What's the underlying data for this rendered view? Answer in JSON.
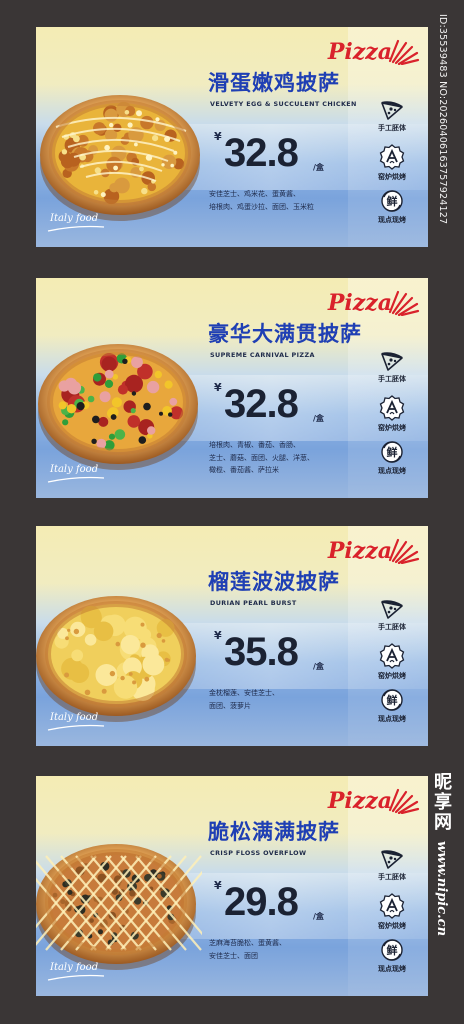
{
  "watermark_id": "ID:35539483 NO:20260406163757924127",
  "site": {
    "brand": "昵享网",
    "url": "www.nipic.cn"
  },
  "colors": {
    "title_blue": "#1f3fb4",
    "logo_red": "#d9222b",
    "background": "#3a3636"
  },
  "cards": [
    {
      "logo": "Pizza",
      "title": "滑蛋嫩鸡披萨",
      "subtitle": "VELVETY EGG & SUCCULENT CHICKEN",
      "currency": "¥",
      "price": "32.8",
      "unit": "/盒",
      "ingredients": [
        "安佳芝士、鸡米花、蛋黄酱、",
        "培根肉、鸡蛋沙拉、面团、玉米粒"
      ],
      "features": [
        {
          "icon": "pizza-slice-icon",
          "label": "手工胚体"
        },
        {
          "icon": "oven-badge-icon",
          "label": "窑炉烘烤"
        },
        {
          "icon": "fresh-badge-icon",
          "label": "现点现烤",
          "badge": "鲜"
        }
      ],
      "tagline": "Italy food"
    },
    {
      "logo": "Pizza",
      "title": "豪华大满贯披萨",
      "subtitle": "SUPREME CARNIVAL PIZZA",
      "currency": "¥",
      "price": "32.8",
      "unit": "/盒",
      "ingredients": [
        "培根肉、青椒、番茄、香肠、",
        "芝士、蘑菇、面团、火腿、洋葱、",
        "橄榄、番茄酱、萨拉米"
      ],
      "features": [
        {
          "icon": "pizza-slice-icon",
          "label": "手工胚体"
        },
        {
          "icon": "oven-badge-icon",
          "label": "窑炉烘烤"
        },
        {
          "icon": "fresh-badge-icon",
          "label": "现点现烤",
          "badge": "鲜"
        }
      ],
      "tagline": "Italy food"
    },
    {
      "logo": "Pizza",
      "title": "榴莲波波披萨",
      "subtitle": "DURIAN PEARL BURST",
      "currency": "¥",
      "price": "35.8",
      "unit": "/盒",
      "ingredients": [
        "金枕榴莲、安佳芝士、",
        "面团、菠萝片"
      ],
      "features": [
        {
          "icon": "pizza-slice-icon",
          "label": "手工胚体"
        },
        {
          "icon": "oven-badge-icon",
          "label": "窑炉烘烤"
        },
        {
          "icon": "fresh-badge-icon",
          "label": "现点现烤",
          "badge": "鲜"
        }
      ],
      "tagline": "Italy food"
    },
    {
      "logo": "Pizza",
      "title": "脆松满满披萨",
      "subtitle": "CRISP FLOSS OVERFLOW",
      "currency": "¥",
      "price": "29.8",
      "unit": "/盒",
      "ingredients": [
        "芝麻海苔脆松、蛋黄酱、",
        "安佳芝士、面团"
      ],
      "features": [
        {
          "icon": "pizza-slice-icon",
          "label": "手工胚体"
        },
        {
          "icon": "oven-badge-icon",
          "label": "窑炉烘烤"
        },
        {
          "icon": "fresh-badge-icon",
          "label": "现点现烤",
          "badge": "鲜"
        }
      ],
      "tagline": "Italy food"
    }
  ]
}
